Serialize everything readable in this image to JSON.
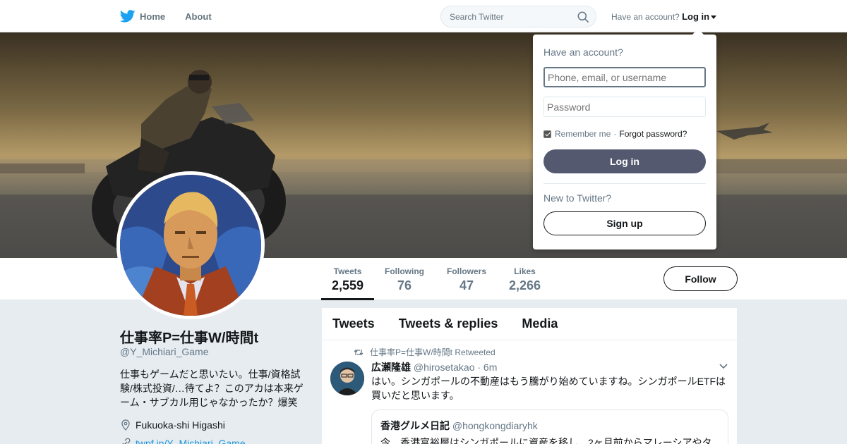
{
  "nav": {
    "home_label": "Home",
    "about_label": "About",
    "search_placeholder": "Search Twitter",
    "account_prompt": "Have an account?",
    "login_label": "Log in"
  },
  "colors": {
    "accent": "#1da1f2",
    "login_button": "#55596f",
    "link": "#1b95e0"
  },
  "profile": {
    "name": "仕事率P=仕事W/時間t",
    "handle": "@Y_Michiari_Game",
    "bio": "仕事もゲームだと思いたい。仕事/資格試験/株式投資/…待てよ？このアカは本来ゲーム・サブカル用じゃなかったか？爆笑",
    "location": "Fukuoka-shi Higashi",
    "url": "twpf.jp/Y_Michiari_Game"
  },
  "stats": [
    {
      "label": "Tweets",
      "value": "2,559"
    },
    {
      "label": "Following",
      "value": "76"
    },
    {
      "label": "Followers",
      "value": "47"
    },
    {
      "label": "Likes",
      "value": "2,266"
    }
  ],
  "follow_label": "Follow",
  "tabs": [
    "Tweets",
    "Tweets & replies",
    "Media"
  ],
  "tweet": {
    "retweet_line": "仕事率P=仕事W/時間t Retweeted",
    "author_name": "広瀬隆雄",
    "author_handle": "@hirosetakao",
    "time": "· 6m",
    "text": "はい。シンガポールの不動産はもう騰がり始めていますね。シンガポールETFは買いだと思います。",
    "quote": {
      "author_name": "香港グルメ日記",
      "author_handle": "@hongkongdiaryhk",
      "text": "今、香港富裕層はシンガポールに資産を移し、2ヶ月前からマレーシアやタ"
    }
  },
  "login_dropdown": {
    "title": "Have an account?",
    "username_placeholder": "Phone, email, or username",
    "password_placeholder": "Password",
    "remember_label": "Remember me",
    "separator": "·",
    "forgot_label": "Forgot password?",
    "login_button": "Log in",
    "new_prompt": "New to Twitter?",
    "signup_button": "Sign up"
  }
}
